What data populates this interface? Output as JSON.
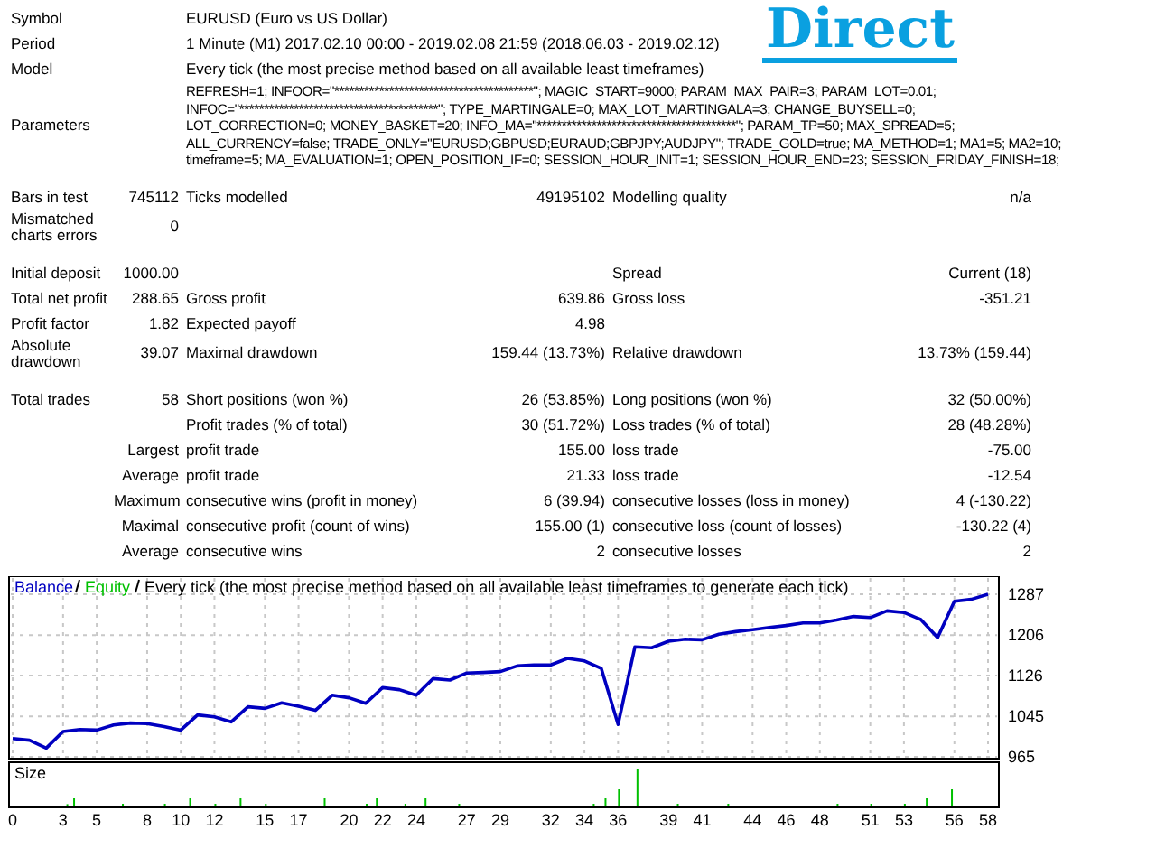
{
  "logo": "Direct",
  "sections": [
    {
      "rows": [
        {
          "kind": "info",
          "label": "Symbol",
          "value": "EURUSD (Euro vs US Dollar)"
        },
        {
          "kind": "info",
          "label": "Period",
          "value": "1 Minute (M1) 2017.02.10 00:00 - 2019.02.08 21:59 (2018.06.03 - 2019.02.12)"
        },
        {
          "kind": "info",
          "label": "Model",
          "value": "Every tick (the most precise method based on all available least timeframes)"
        },
        {
          "kind": "parameters",
          "label": "Parameters",
          "lines": [
            "REFRESH=1; INFOOR=\"****************************************\"; MAGIC_START=9000; PARAM_MAX_PAIR=3; PARAM_LOT=0.01;",
            "INFOC=\"****************************************\"; TYPE_MARTINGALE=0; MAX_LOT_MARTINGALA=3; CHANGE_BUYSELL=0;",
            "LOT_CORRECTION=0; MONEY_BASKET=20; INFO_MA=\"****************************************\"; PARAM_TP=50; MAX_SPREAD=5;",
            "ALL_CURRENCY=false; TRADE_ONLY=\"EURUSD;GBPUSD;EURAUD;GBPJPY;AUDJPY\"; TRADE_GOLD=true; MA_METHOD=1; MA1=5; MA2=10;",
            "timeframe=5; MA_EVALUATION=1; OPEN_POSITION_IF=0; SESSION_HOUR_INIT=1; SESSION_HOUR_END=23; SESSION_FRIDAY_FINISH=18;"
          ]
        }
      ]
    },
    {
      "rows": [
        {
          "kind": "stats",
          "c1": "Bars in test",
          "c2": "745112",
          "c3": "Ticks modelled",
          "c4": "49195102",
          "c5": "Modelling quality",
          "c6": "n/a"
        },
        {
          "kind": "stats",
          "c1": "Mismatched charts errors",
          "c2": "0"
        }
      ]
    },
    {
      "rows": [
        {
          "kind": "stats",
          "c1": "Initial deposit",
          "c2": "1000.00",
          "c5": "Spread",
          "c6": "Current (18)"
        },
        {
          "kind": "stats",
          "c1": "Total net profit",
          "c2": "288.65",
          "c3": "Gross profit",
          "c4": "639.86",
          "c5": "Gross loss",
          "c6": "-351.21"
        },
        {
          "kind": "stats",
          "c1": "Profit factor",
          "c2": "1.82",
          "c3": "Expected payoff",
          "c4": "4.98"
        },
        {
          "kind": "stats",
          "c1": "Absolute drawdown",
          "c2": "39.07",
          "c3": "Maximal drawdown",
          "c4": "159.44 (13.73%)",
          "c5": "Relative drawdown",
          "c6": "13.73% (159.44)"
        }
      ]
    },
    {
      "rows": [
        {
          "kind": "stats",
          "c1": "Total trades",
          "c2": "58",
          "c3": "Short positions (won %)",
          "c4": "26 (53.85%)",
          "c5": "Long positions (won %)",
          "c6": "32 (50.00%)"
        },
        {
          "kind": "stats",
          "c3": "Profit trades (% of total)",
          "c4": "30 (51.72%)",
          "c5": "Loss trades (% of total)",
          "c6": "28 (48.28%)"
        },
        {
          "kind": "stats",
          "c2": "Largest",
          "c3": "profit trade",
          "c4": "155.00",
          "c5": "loss trade",
          "c6": "-75.00"
        },
        {
          "kind": "stats",
          "c2": "Average",
          "c3": "profit trade",
          "c4": "21.33",
          "c5": "loss trade",
          "c6": "-12.54"
        },
        {
          "kind": "stats",
          "c2": "Maximum",
          "c3": "consecutive wins (profit in money)",
          "c4": "6 (39.94)",
          "c5": "consecutive losses (loss in money)",
          "c6": "4 (-130.22)"
        },
        {
          "kind": "stats",
          "c2": "Maximal",
          "c3": "consecutive profit (count of wins)",
          "c4": "155.00 (1)",
          "c5": "consecutive loss (count of losses)",
          "c6": "-130.22 (4)"
        },
        {
          "kind": "stats",
          "c2": "Average",
          "c3": "consecutive wins",
          "c4": "2",
          "c5": "consecutive losses",
          "c6": "2"
        }
      ]
    }
  ],
  "chart": {
    "legend": [
      {
        "label": "Equity",
        "color": "#00c000"
      }
    ],
    "size_label": "Size",
    "chart_data": {
      "type": "line",
      "title": "Every tick (the most precise method based on all available least timeframes to generate each tick)",
      "x": [
        0,
        1,
        2,
        3,
        4,
        5,
        6,
        7,
        8,
        9,
        10,
        11,
        12,
        13,
        14,
        15,
        16,
        17,
        18,
        19,
        20,
        21,
        22,
        23,
        24,
        25,
        26,
        27,
        28,
        29,
        30,
        31,
        32,
        33,
        34,
        35,
        36,
        37,
        38,
        39,
        40,
        41,
        42,
        43,
        44,
        45,
        46,
        47,
        48,
        49,
        50,
        51,
        52,
        53,
        54,
        55,
        56,
        57,
        58
      ],
      "series": [
        {
          "name": "Balance",
          "color": "#0000c0",
          "values": [
            1001,
            998,
            982,
            1015,
            1019,
            1018,
            1028,
            1032,
            1031,
            1025,
            1018,
            1048,
            1044,
            1034,
            1064,
            1061,
            1072,
            1065,
            1057,
            1087,
            1082,
            1071,
            1102,
            1098,
            1087,
            1120,
            1117,
            1131,
            1132,
            1134,
            1145,
            1147,
            1147,
            1160,
            1155,
            1140,
            1029,
            1183,
            1181,
            1194,
            1198,
            1197,
            1208,
            1213,
            1217,
            1221,
            1225,
            1230,
            1230,
            1236,
            1243,
            1241,
            1254,
            1251,
            1237,
            1201,
            1273,
            1277,
            1287
          ]
        }
      ],
      "xlim": [
        0,
        58
      ],
      "ylim": [
        965,
        1287
      ],
      "xticks": [
        0,
        3,
        5,
        8,
        10,
        12,
        15,
        17,
        20,
        22,
        24,
        27,
        29,
        32,
        34,
        36,
        39,
        41,
        44,
        46,
        48,
        51,
        53,
        56,
        58
      ],
      "yticks": [
        965,
        1045,
        1126,
        1206,
        1287
      ],
      "grid": true
    }
  }
}
